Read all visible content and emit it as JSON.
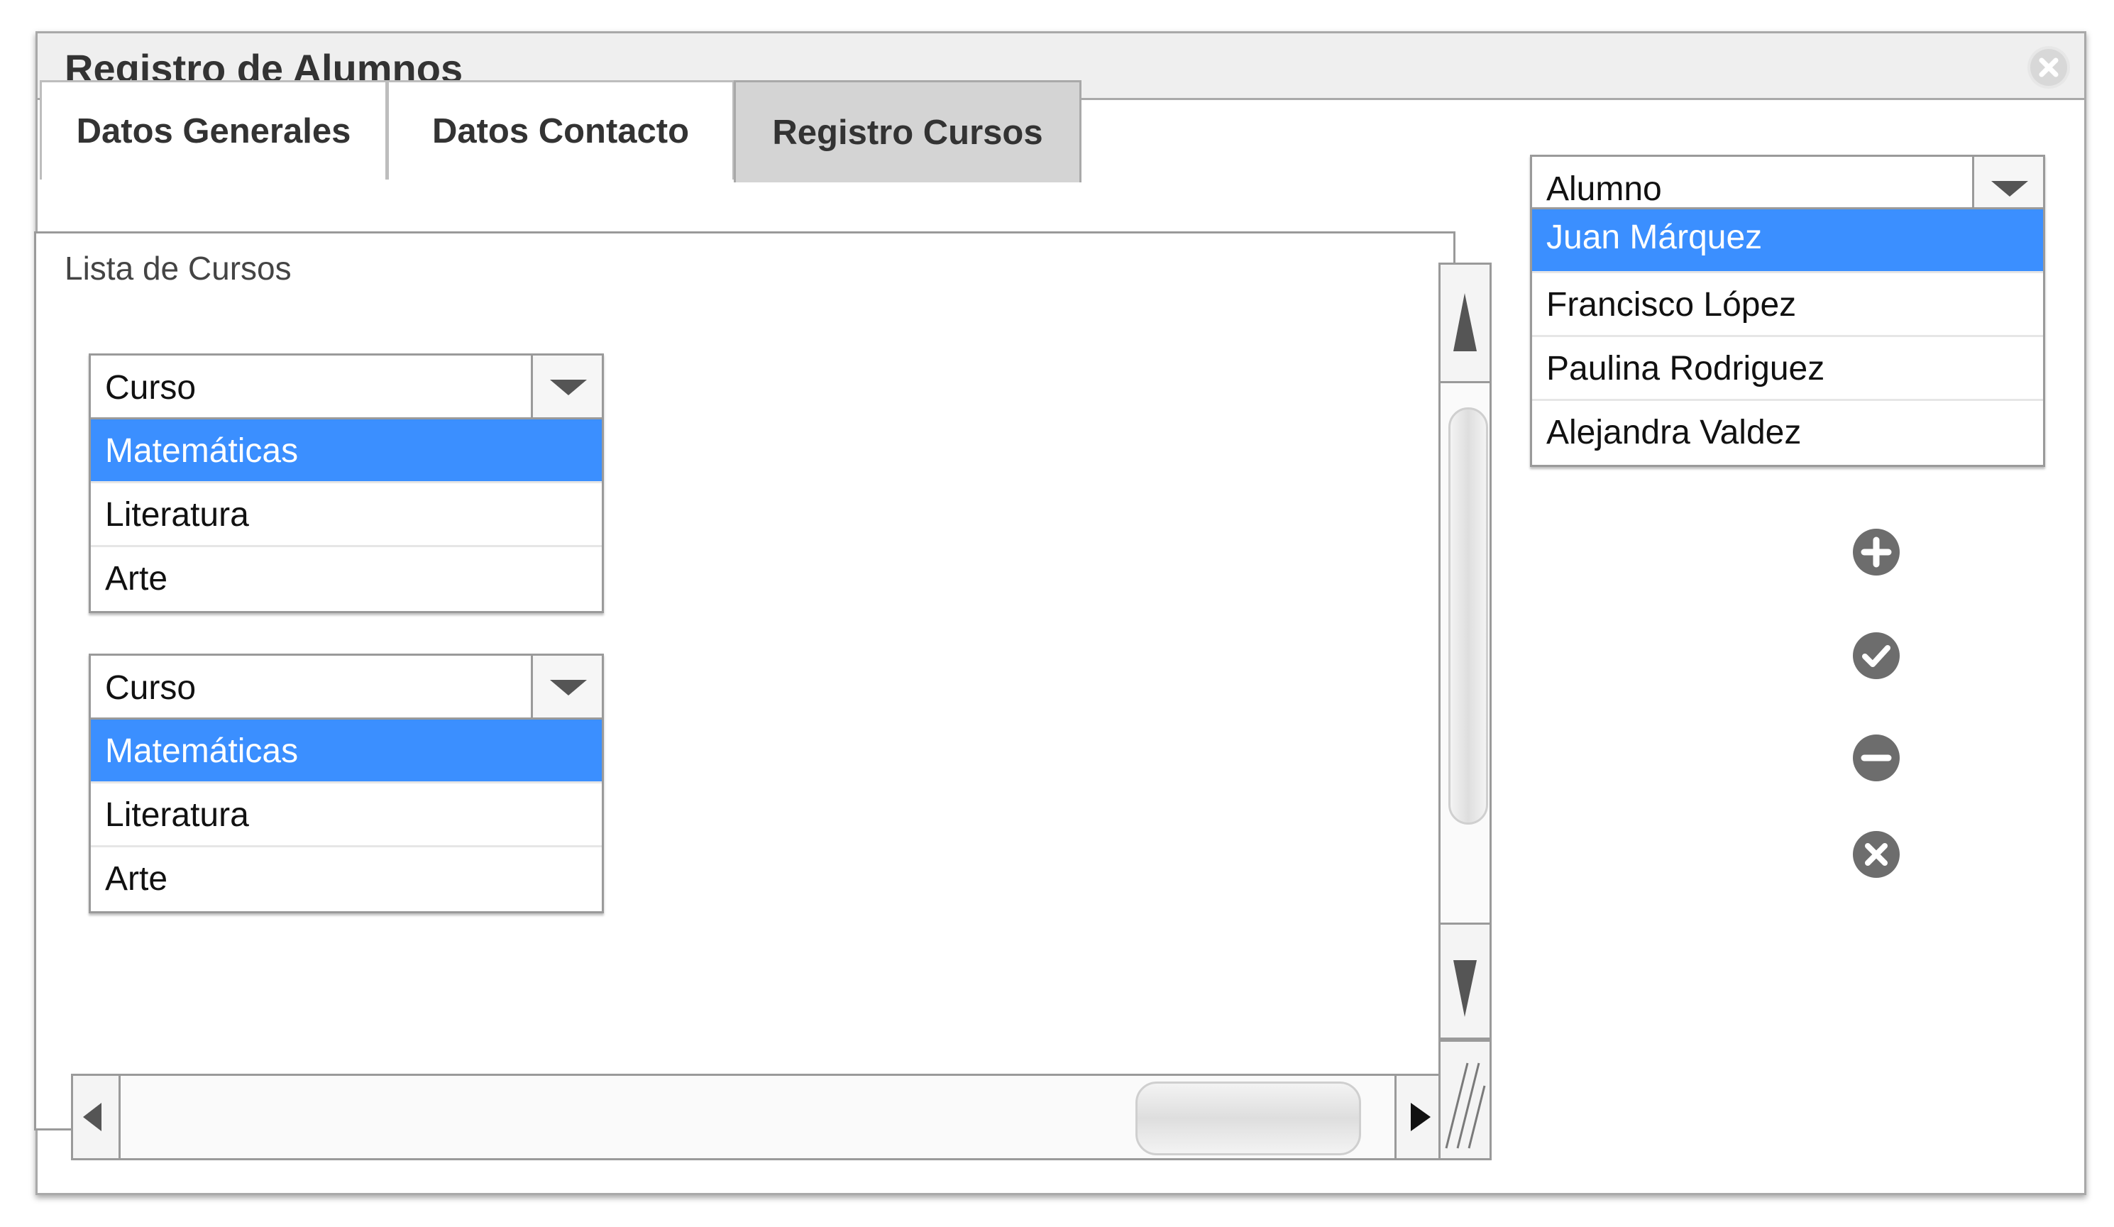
{
  "window": {
    "title": "Registro de Alumnos"
  },
  "tabs": [
    {
      "label": "Datos Generales",
      "active": false
    },
    {
      "label": "Datos Contacto",
      "active": false
    },
    {
      "label": "Registro Cursos",
      "active": true
    }
  ],
  "panel": {
    "label": "Lista de Cursos",
    "course_dropdowns": [
      {
        "header": "Curso",
        "items": [
          "Matemáticas",
          "Literatura",
          "Arte"
        ],
        "selected": "Matemáticas"
      },
      {
        "header": "Curso",
        "items": [
          "Matemáticas",
          "Literatura",
          "Arte"
        ],
        "selected": "Matemáticas"
      }
    ]
  },
  "student_dropdown": {
    "header": "Alumno",
    "items": [
      "Juan Márquez",
      "Francisco López",
      "Paulina Rodriguez",
      "Alejandra Valdez"
    ],
    "selected": "Juan Márquez"
  },
  "actions": [
    "add-icon",
    "check-icon",
    "remove-icon",
    "cancel-icon"
  ],
  "colors": {
    "selection": "#3b8fff",
    "icon": "#6d6d6d",
    "active_tab": "#d4d4d4"
  }
}
